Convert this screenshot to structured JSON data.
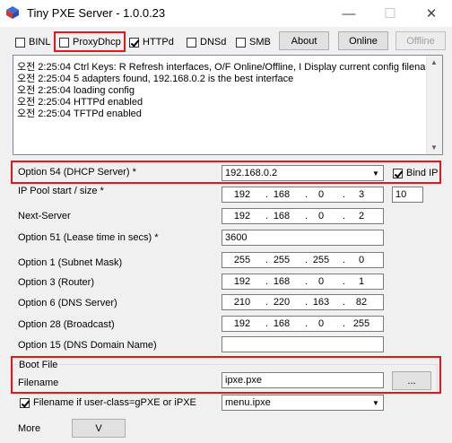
{
  "window": {
    "title": "Tiny PXE Server - 1.0.0.23",
    "minimize": "—",
    "maximize": "☐",
    "close": "✕"
  },
  "toolbar": {
    "binl": {
      "label": "BINL",
      "checked": false
    },
    "proxydhcp": {
      "label": "ProxyDhcp",
      "checked": false
    },
    "httpd": {
      "label": "HTTPd",
      "checked": true
    },
    "dnsd": {
      "label": "DNSd",
      "checked": false
    },
    "smb": {
      "label": "SMB",
      "checked": false
    },
    "about_label": "About",
    "online_label": "Online",
    "offline_label": "Offline"
  },
  "log": [
    "오전 2:25:04 Ctrl Keys: R Refresh interfaces, O/F Online/Offline, I Display current config filename",
    "오전 2:25:04 5 adapters found, 192.168.0.2 is the best interface",
    "오전 2:25:04 loading config",
    "오전 2:25:04 HTTPd enabled",
    "오전 2:25:04 TFTPd enabled"
  ],
  "form": {
    "option54": {
      "label": "Option 54 (DHCP Server) *",
      "value": "192.168.0.2"
    },
    "bind_ip": {
      "label": "Bind IP",
      "checked": true
    },
    "ip_pool": {
      "label": "IP Pool start / size *",
      "octets": [
        "192",
        "168",
        "0",
        "3"
      ],
      "size": "10"
    },
    "next_server": {
      "label": "Next-Server",
      "octets": [
        "192",
        "168",
        "0",
        "2"
      ]
    },
    "option51": {
      "label": "Option 51 (Lease time in secs) *",
      "value": "3600"
    },
    "option1": {
      "label": "Option 1  (Subnet Mask)",
      "octets": [
        "255",
        "255",
        "255",
        "0"
      ]
    },
    "option3": {
      "label": "Option 3  (Router)",
      "octets": [
        "192",
        "168",
        "0",
        "1"
      ]
    },
    "option6": {
      "label": "Option 6  (DNS Server)",
      "octets": [
        "210",
        "220",
        "163",
        "82"
      ]
    },
    "option28": {
      "label": "Option 28 (Broadcast)",
      "octets": [
        "192",
        "168",
        "0",
        "255"
      ]
    },
    "option15": {
      "label": "Option 15 (DNS Domain Name)",
      "value": ""
    }
  },
  "bootfile": {
    "group_label": "Boot File",
    "filename_label": "Filename",
    "filename_value": "ipxe.pxe",
    "browse_label": "...",
    "userclass": {
      "label": "Filename if user-class=gPXE or iPXE",
      "checked": true
    },
    "userclass_value": "menu.ipxe"
  },
  "footer": {
    "more_label": "More",
    "v_label": "V"
  },
  "colors": {
    "highlight": "#e0181e",
    "window_bg": "#f0f0f0"
  }
}
